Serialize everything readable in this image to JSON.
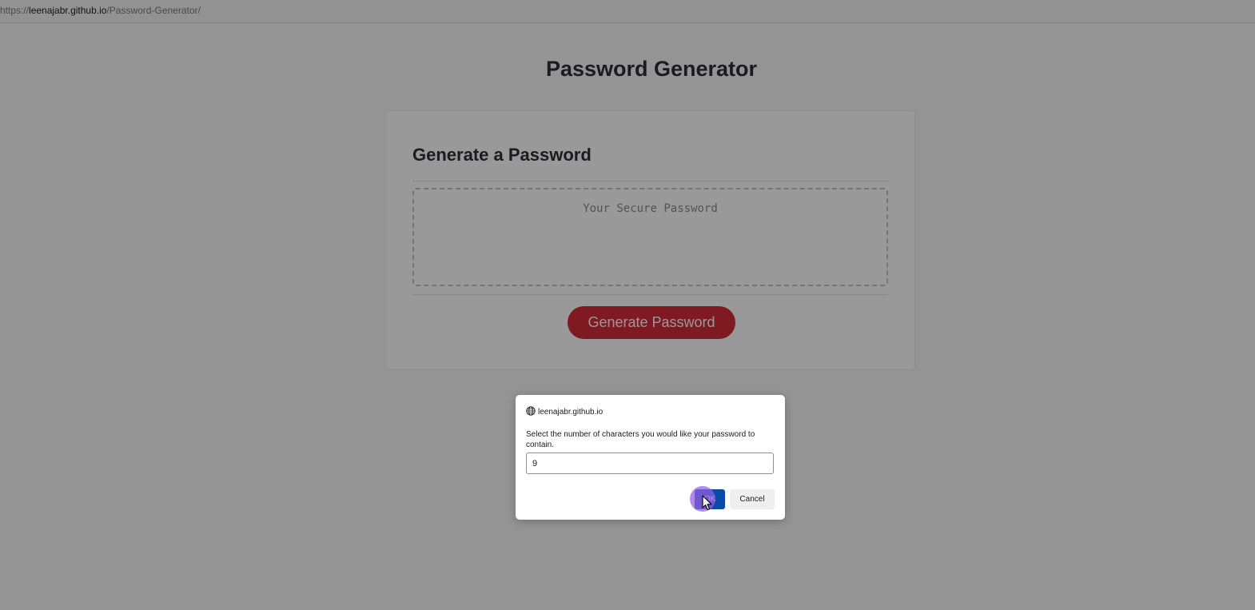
{
  "browser": {
    "url_scheme": "https://",
    "url_host": "leenajabr.github.io",
    "url_path": "/Password-Generator/"
  },
  "page": {
    "title": "Password Generator",
    "card_title": "Generate a Password",
    "password_placeholder": "Your Secure Password",
    "generate_button": "Generate Password"
  },
  "dialog": {
    "origin": "leenajabr.github.io",
    "origin_icon": "globe-icon",
    "message": "Select the number of characters you would like your password to contain.",
    "input_value": "9",
    "ok_label": "OK",
    "cancel_label": "Cancel"
  },
  "colors": {
    "generate_button": "#d42c3b",
    "ok_button": "#0a4aa8",
    "click_indicator": "#965fe1"
  }
}
